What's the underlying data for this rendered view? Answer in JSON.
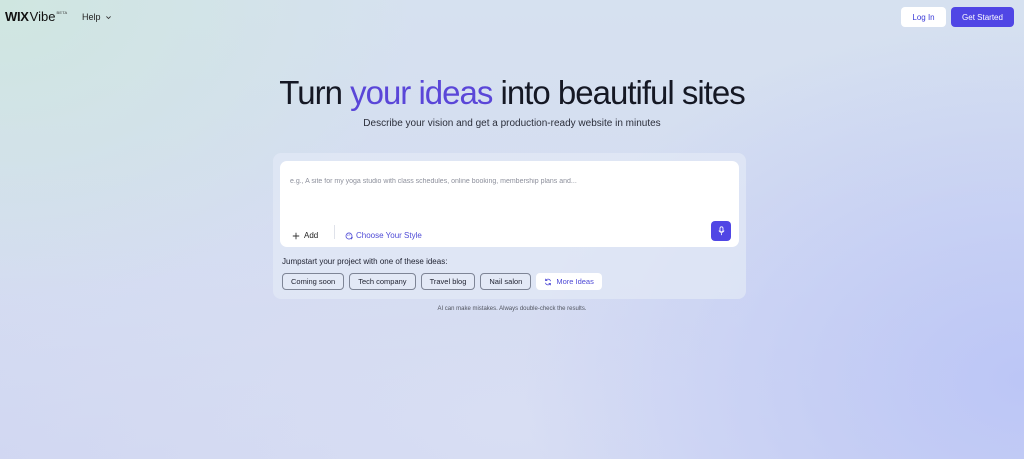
{
  "header": {
    "logo_wix": "WIX",
    "logo_vibe": "Vibe",
    "logo_beta": "BETA",
    "help_label": "Help",
    "login_label": "Log In",
    "get_started_label": "Get Started"
  },
  "hero": {
    "headline_pre": "Turn ",
    "headline_accent": "your ideas",
    "headline_post": " into beautiful sites",
    "subhead": "Describe your vision and get a production-ready website in minutes"
  },
  "prompt": {
    "placeholder": "e.g., A site for my yoga studio with class schedules, online booking, membership plans and...",
    "add_label": "Add",
    "style_label": "Choose Your Style"
  },
  "ideas": {
    "heading": "Jumpstart your project with one of these ideas:",
    "chips": [
      "Coming soon",
      "Tech company",
      "Travel blog",
      "Nail salon"
    ],
    "more_label": "More Ideas"
  },
  "disclaimer": "AI can make mistakes. Always double-check the results.",
  "colors": {
    "accent": "#5046e5",
    "accent_text": "#5a46d8"
  },
  "icons": [
    "chevron-down-icon",
    "plus-icon",
    "palette-icon",
    "microphone-icon",
    "refresh-icon"
  ]
}
